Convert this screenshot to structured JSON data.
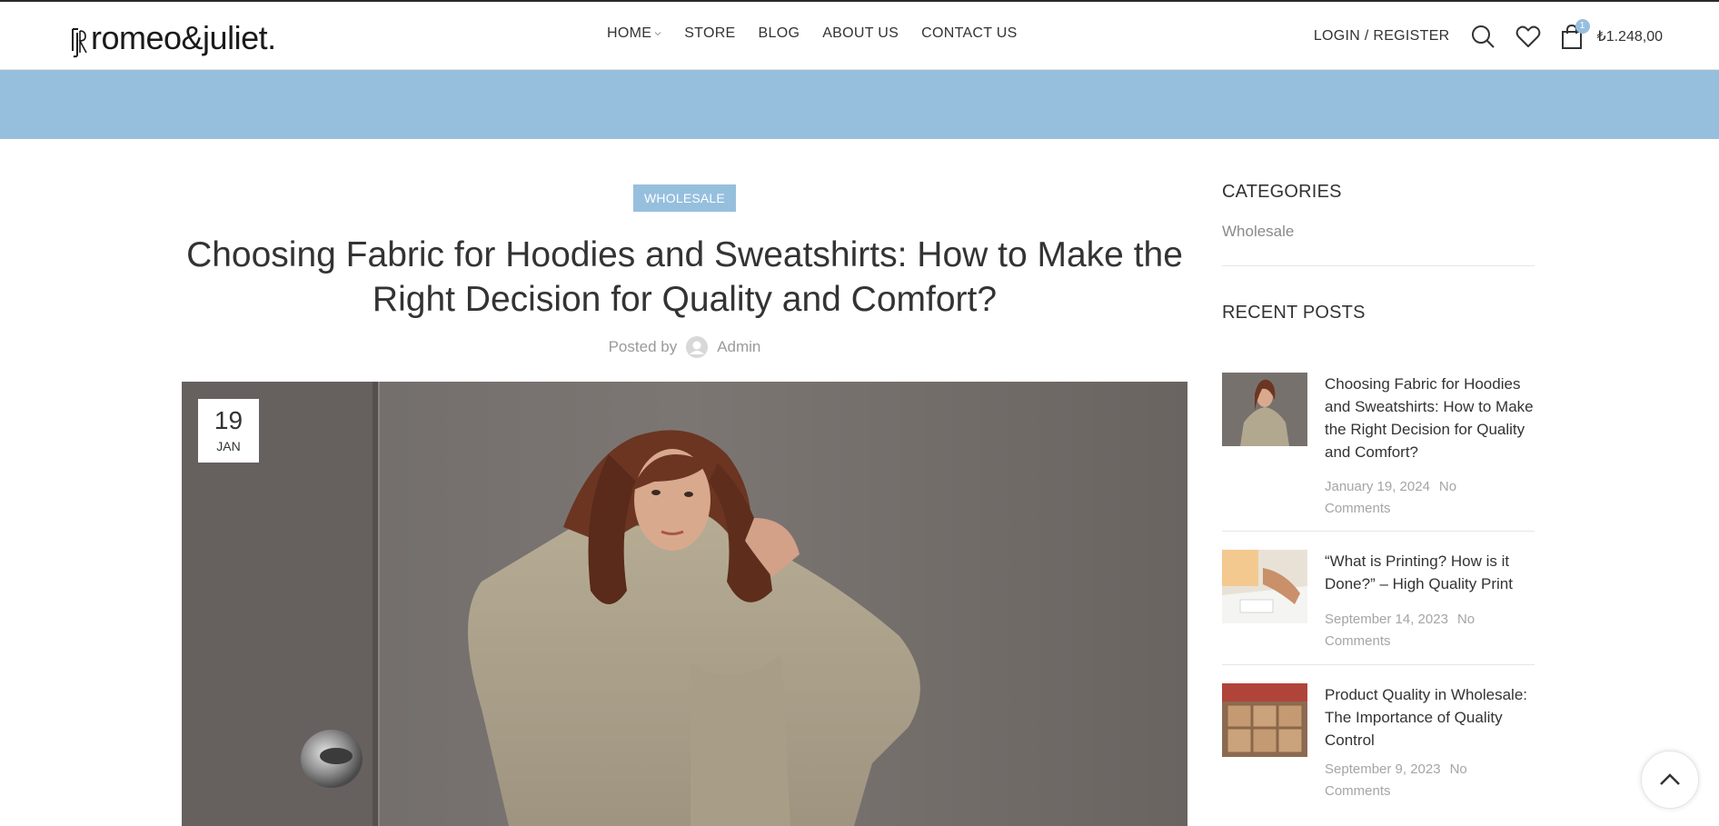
{
  "brand": {
    "logo_text": "romeo&juliet."
  },
  "nav": {
    "items": [
      {
        "label": "HOME"
      },
      {
        "label": "STORE"
      },
      {
        "label": "BLOG"
      },
      {
        "label": "ABOUT US"
      },
      {
        "label": "CONTACT US"
      }
    ]
  },
  "header_right": {
    "login_label": "LOGIN / REGISTER",
    "cart_count": "1",
    "cart_total": "₺1.248,00"
  },
  "colors": {
    "accent": "#96bfde",
    "text": "#333333",
    "muted": "#9a9a9a"
  },
  "post": {
    "category": "WHOLESALE",
    "title": "Choosing Fabric for Hoodies and Sweatshirts: How to Make the Right Decision for Quality and Comfort?",
    "posted_by_label": "Posted by",
    "author": "Admin",
    "date_day": "19",
    "date_month": "JAN"
  },
  "sidebar": {
    "categories_title": "CATEGORIES",
    "categories": [
      {
        "label": "Wholesale"
      }
    ],
    "recent_title": "RECENT POSTS",
    "recent_posts": [
      {
        "title": "Choosing Fabric for Hoodies and Sweatshirts: How to Make the Right Decision for Quality and Comfort?",
        "date": "January 19, 2024",
        "comments": "No Comments"
      },
      {
        "title": "“What is Printing? How is it Done?” – High Quality Print",
        "date": "September 14, 2023",
        "comments": "No Comments"
      },
      {
        "title": "Product Quality in Wholesale: The Importance of Quality Control",
        "date": "September 9, 2023",
        "comments": "No Comments"
      }
    ]
  },
  "icons": {
    "search": "search-icon",
    "wishlist": "heart-icon",
    "cart": "shopping-bag-icon",
    "scroll_top": "chevron-up-icon"
  }
}
